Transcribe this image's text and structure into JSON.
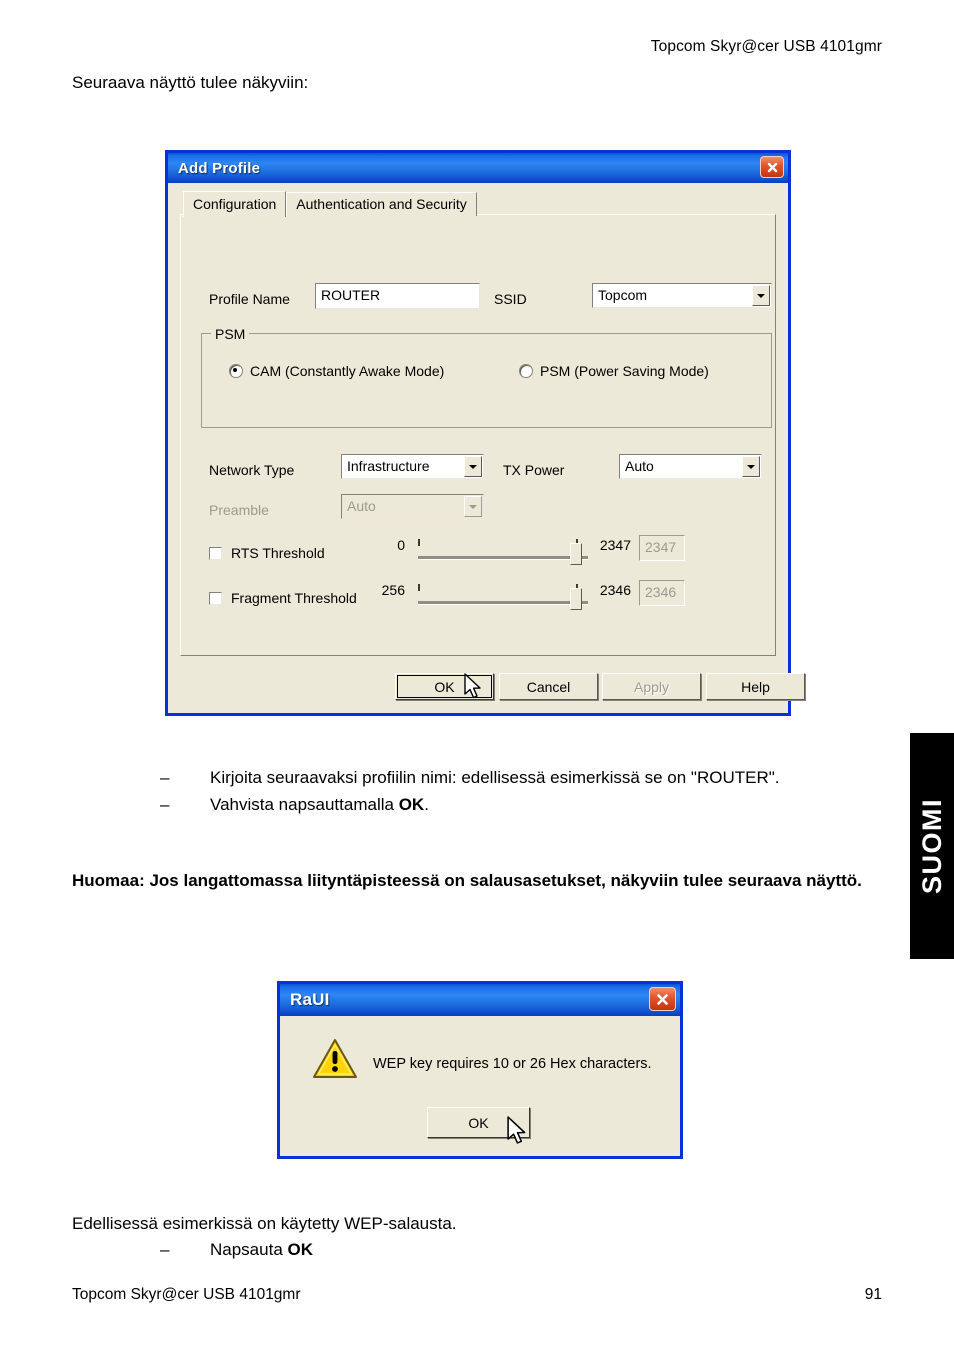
{
  "document": {
    "header_right": "Topcom Skyr@cer USB 4101gmr",
    "intro": "Seuraava näyttö tulee näkyviin:",
    "bullets": [
      {
        "dash": "–",
        "text": "Kirjoita seuraavaksi profiilin nimi: edellisessä esimerkissä se on \"ROUTER\"."
      },
      {
        "dash": "–",
        "text_before": "Vahvista napsauttamalla ",
        "bold": "OK",
        "text_after": "."
      }
    ],
    "note": "Huomaa: Jos langattomassa liityntäpisteessä on salausasetukset, näkyviin tulee seuraava näyttö.",
    "tail_line": "Edellisessä esimerkissä on käytetty WEP-salausta.",
    "tail_bullet": {
      "dash": "–",
      "text_before": "Napsauta ",
      "bold": "OK"
    },
    "footer_left": "Topcom Skyr@cer USB 4101gmr",
    "footer_right": "91",
    "side_tab": "SUOMI"
  },
  "add_profile_dialog": {
    "title": "Add Profile",
    "close_icon": "close-icon",
    "tabs": [
      {
        "label": "Configuration",
        "active": true
      },
      {
        "label": "Authentication and Security",
        "active": false
      }
    ],
    "profile_name": {
      "label": "Profile Name",
      "value": "ROUTER"
    },
    "ssid": {
      "label": "SSID",
      "value": "Topcom",
      "dropdown_icon": "chevron-down-icon"
    },
    "psm_group": {
      "title": "PSM",
      "options": [
        {
          "label": "CAM (Constantly Awake Mode)",
          "selected": true
        },
        {
          "label": "PSM (Power Saving Mode)",
          "selected": false
        }
      ]
    },
    "network_type": {
      "label": "Network Type",
      "value": "Infrastructure",
      "dropdown_icon": "chevron-down-icon"
    },
    "tx_power": {
      "label": "TX Power",
      "value": "Auto",
      "dropdown_icon": "chevron-down-icon"
    },
    "preamble": {
      "label": "Preamble",
      "value": "Auto",
      "disabled": true,
      "dropdown_icon": "chevron-down-icon"
    },
    "rts_threshold": {
      "label": "RTS Threshold",
      "checked": false,
      "min": "0",
      "max": "2347",
      "value": "2347"
    },
    "fragment_threshold": {
      "label": "Fragment Threshold",
      "checked": false,
      "min": "256",
      "max": "2346",
      "value": "2346"
    },
    "buttons": [
      {
        "label": "OK",
        "state": "default"
      },
      {
        "label": "Cancel",
        "state": "normal"
      },
      {
        "label": "Apply",
        "state": "disabled"
      },
      {
        "label": "Help",
        "state": "normal"
      }
    ]
  },
  "raui_dialog": {
    "title": "RaUI",
    "close_icon": "close-icon",
    "warning_icon": "warning-triangle-icon",
    "message": "WEP key requires 10 or 26 Hex characters.",
    "ok_button": "OK"
  },
  "colors": {
    "titlebar_blue": "#0831d9",
    "dialog_face": "#ece9d8",
    "close_red": "#c3340f",
    "warning_yellow": "#ffd400",
    "side_tab_bg": "#000000"
  }
}
